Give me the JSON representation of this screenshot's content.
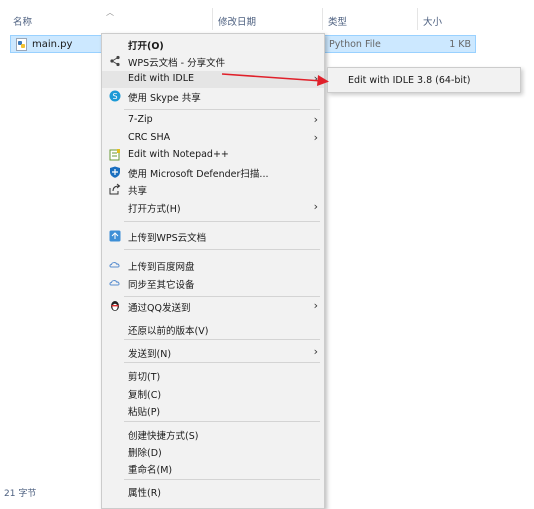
{
  "header": {
    "name": "名称",
    "date": "修改日期",
    "type": "类型",
    "size": "大小"
  },
  "file": {
    "name": "main.py",
    "type": "Python File",
    "size": "1 KB"
  },
  "status": {
    "count": "21 字节"
  },
  "menu": {
    "open": "打开(O)",
    "wps_share": "WPS云文档 - 分享文件",
    "edit_idle": "Edit with IDLE",
    "skype": "使用 Skype 共享",
    "zip": "7-Zip",
    "crc": "CRC SHA",
    "notepad": "Edit with Notepad++",
    "defender": "使用 Microsoft Defender扫描...",
    "share": "共享",
    "open_with": "打开方式(H)",
    "upload_wps": "上传到WPS云文档",
    "upload_baidu": "上传到百度网盘",
    "sync_devices": "同步至其它设备",
    "qq_send": "通过QQ发送到",
    "restore": "还原以前的版本(V)",
    "send_to": "发送到(N)",
    "cut": "剪切(T)",
    "copy": "复制(C)",
    "paste": "粘贴(P)",
    "shortcut": "创建快捷方式(S)",
    "delete": "删除(D)",
    "rename": "重命名(M)",
    "properties": "属性(R)"
  },
  "submenu": {
    "idle38": "Edit with IDLE 3.8 (64-bit)"
  },
  "colors": {
    "selection": "#cce8ff",
    "arrow": "#e0202a",
    "menu_bg": "#f2f2f2"
  }
}
